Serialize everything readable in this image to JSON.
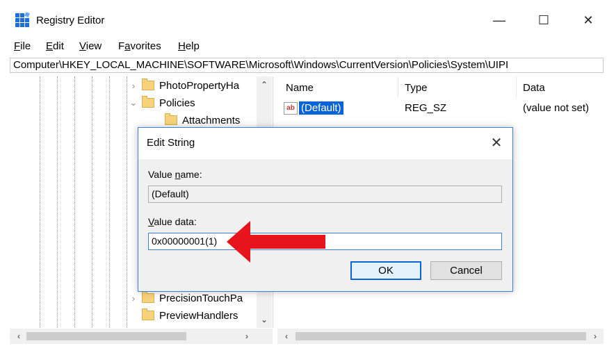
{
  "window": {
    "title": "Registry Editor",
    "minimize_glyph": "—",
    "maximize_glyph": "☐",
    "close_glyph": "✕"
  },
  "menu": {
    "items": [
      {
        "accel": "F",
        "rest": "ile"
      },
      {
        "accel": "E",
        "rest": "dit"
      },
      {
        "accel": "V",
        "rest": "iew"
      },
      {
        "pre": "F",
        "accel": "a",
        "rest": "vorites"
      },
      {
        "accel": "H",
        "rest": "elp"
      }
    ]
  },
  "address": "Computer\\HKEY_LOCAL_MACHINE\\SOFTWARE\\Microsoft\\Windows\\CurrentVersion\\Policies\\System\\UIPI",
  "tree": {
    "nodes": [
      {
        "label": "PhotoPropertyHa",
        "chevron": "›"
      },
      {
        "label": "Policies",
        "chevron": "⌄"
      },
      {
        "label": "Attachments"
      },
      {
        "label": "PrecisionTouchPa",
        "chevron": "›"
      },
      {
        "label": "PreviewHandlers"
      }
    ]
  },
  "list": {
    "columns": [
      "Name",
      "Type",
      "Data"
    ],
    "rows": [
      {
        "icon": "ab",
        "name": "(Default)",
        "type": "REG_SZ",
        "data": "(value not set)"
      }
    ]
  },
  "dialog": {
    "title": "Edit String",
    "close_glyph": "✕",
    "value_name_label_pre": "Value ",
    "value_name_label_accel": "n",
    "value_name_label_post": "ame:",
    "value_name": "(Default)",
    "value_data_label_accel": "V",
    "value_data_label_post": "alue data:",
    "value_data": "0x00000001(1)",
    "ok_label": "OK",
    "cancel_label": "Cancel"
  },
  "scroll": {
    "up": "⌃",
    "down": "⌄",
    "left": "‹",
    "right": "›"
  },
  "colors": {
    "selection": "#0a64d8",
    "dialog_border": "#3b82d6",
    "arrow": "#e8141b",
    "folder": "#f6d37a"
  }
}
